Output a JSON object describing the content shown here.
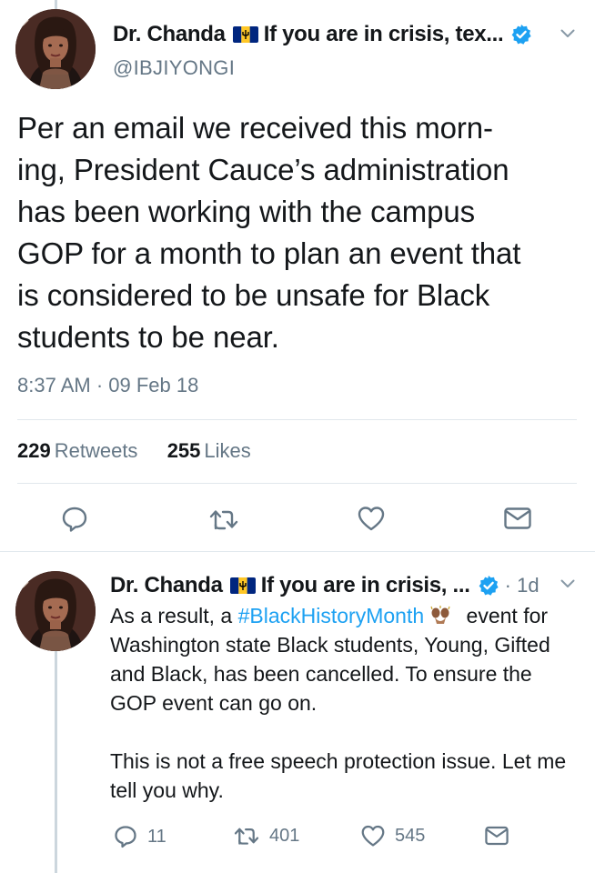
{
  "main_tweet": {
    "display_name": "Dr. Chanda",
    "name_suffix": "If you are in crisis, tex...",
    "handle": "@IBJIYONGI",
    "text": "Per an email we received this morn-\ning, President Cauce’s administration\nhas been working with the campus\nGOP for a month to plan an event that\nis considered to be unsafe for Black\nstudents to be near.",
    "timestamp": "8:37 AM · 09 Feb 18",
    "retweets_count": "229",
    "retweets_label": "Retweets",
    "likes_count": "255",
    "likes_label": "Likes",
    "actions": [
      "reply-icon",
      "retweet-icon",
      "like-icon",
      "direct-message-icon"
    ]
  },
  "reply_tweet": {
    "display_name": "Dr. Chanda",
    "name_suffix": "If you are in crisis, ...",
    "time": "· 1d",
    "text_before_hashtag": "As a result, a ",
    "hashtag": "#BlackHistoryMonth",
    "text_after_hashtag": " event for Washington state Black students, Young, Gifted and Black, has been cancelled. To ensure the GOP event can go on.",
    "text_paragraph_2": "This is not a free speech protection issue. Let me tell you why.",
    "reply_count": "11",
    "retweet_count": "401",
    "like_count": "545"
  },
  "colors": {
    "text": "#14171a",
    "secondary": "#657786",
    "link": "#1da1f2",
    "divider": "#e1e8ed",
    "verified": "#1da1f2",
    "thread_line": "#ccd6dd"
  },
  "icons": {
    "flag": "barbados-flag-icon",
    "verified": "verified-badge-icon",
    "caret": "chevron-down-icon",
    "emoji": "raised-hands-emoji-icon"
  }
}
